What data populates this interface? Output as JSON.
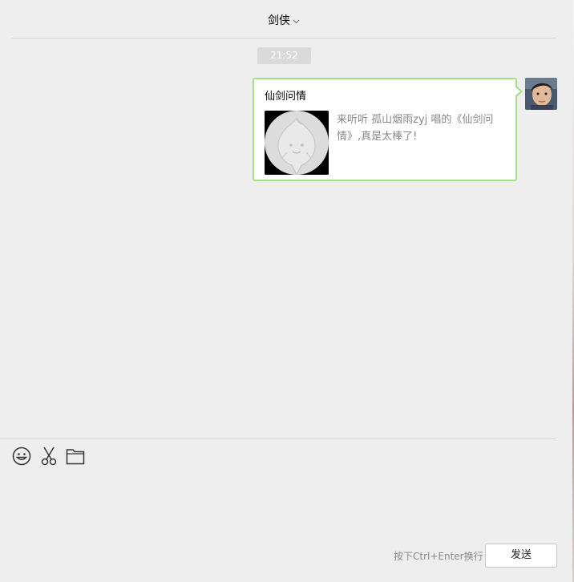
{
  "chat": {
    "title": "剑侠"
  },
  "messages": [
    {
      "timestamp": "21:52",
      "card_title": "仙剑问情",
      "card_description": "来听听 孤山烟雨zyj 唱的《仙剑问情》,真是太棒了!"
    }
  ],
  "composer": {
    "hint": "按下Ctrl+Enter换行",
    "send_label": "发送"
  },
  "icons": {
    "title_dropdown": "chevron-down-icon",
    "emoji": "emoji-icon",
    "screenshot": "scissors-icon",
    "file": "folder-icon"
  },
  "colors": {
    "background": "#eeeeee",
    "bubble_border": "#a8dd86",
    "timestamp_bg": "#dadada"
  }
}
